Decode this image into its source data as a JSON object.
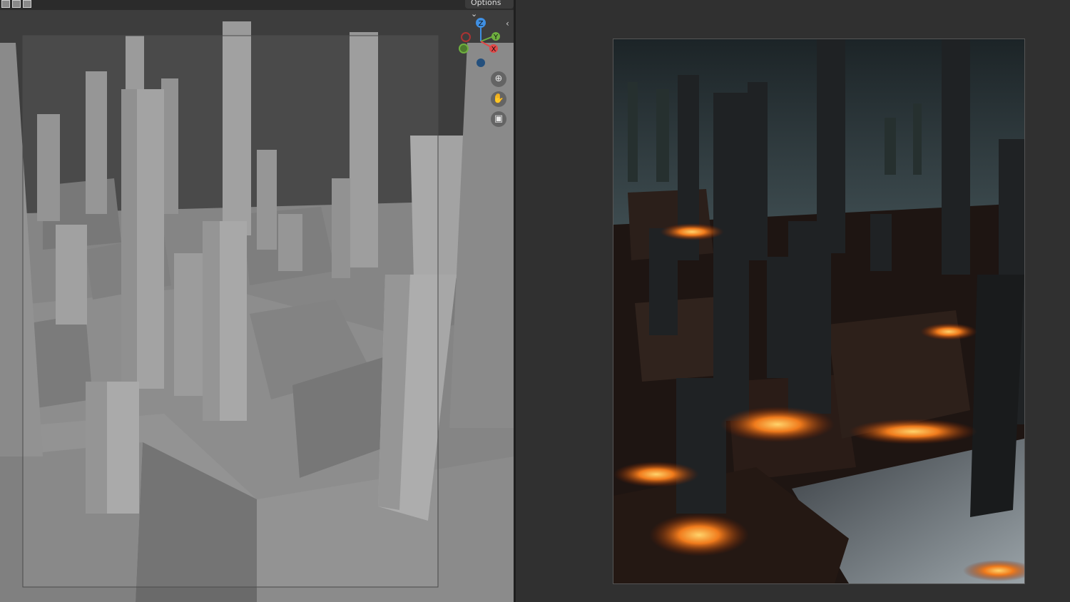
{
  "viewport": {
    "header": {
      "options_label": "Options ⌄"
    },
    "gizmo": {
      "z_label": "Z",
      "y_label": "Y",
      "x_label": "X"
    },
    "nav_tools": [
      {
        "name": "zoom-icon",
        "glyph": "⊕"
      },
      {
        "name": "pan-hand-icon",
        "glyph": "✋"
      },
      {
        "name": "camera-icon",
        "glyph": "▣"
      }
    ]
  },
  "colors": {
    "editor_bg": "#303030",
    "viewport_bg": "#3d3d3d",
    "gizmo_x": "#e24848",
    "gizmo_y": "#6fb03f",
    "gizmo_z": "#3f8fe2"
  }
}
